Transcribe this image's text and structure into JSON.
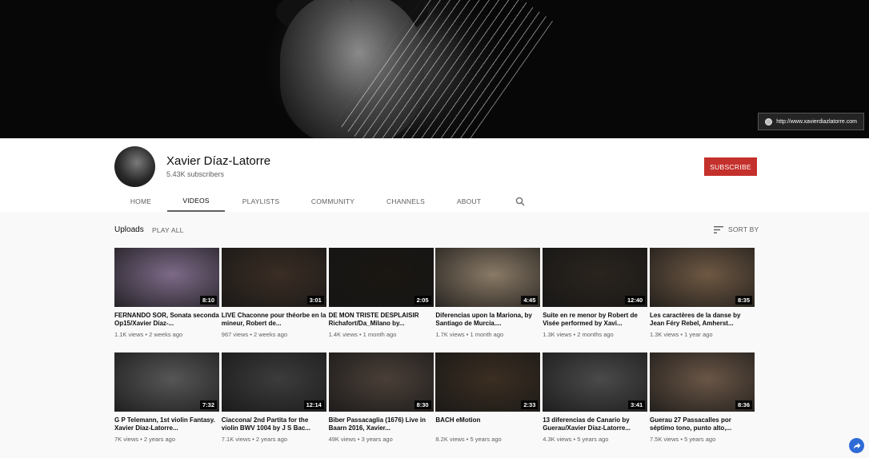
{
  "banner": {
    "link_text": "http://www.xavierdiazlatorre.com"
  },
  "channel": {
    "name": "Xavier Díaz-Latorre",
    "subscribers": "5.43K subscribers",
    "subscribe_label": "SUBSCRIBE"
  },
  "tabs": [
    {
      "label": "HOME"
    },
    {
      "label": "VIDEOS"
    },
    {
      "label": "PLAYLISTS"
    },
    {
      "label": "COMMUNITY"
    },
    {
      "label": "CHANNELS"
    },
    {
      "label": "ABOUT"
    }
  ],
  "section": {
    "title": "Uploads",
    "play_all": "PLAY ALL",
    "sort_by": "SORT BY"
  },
  "videos": [
    {
      "title": "FERNANDO SOR, Sonata seconda Op15/Xavier Díaz-...",
      "views": "1.1K views",
      "age": "2 weeks ago",
      "duration": "8:10",
      "thumb_bg": "#7d6a88"
    },
    {
      "title": "LIVE Chaconne pour théorbe en la mineur, Robert de...",
      "views": "967 views",
      "age": "2 weeks ago",
      "duration": "3:01",
      "thumb_bg": "#3a2d24"
    },
    {
      "title": "DE MON TRISTE DESPLAISIR Richafort/Da_Milano by...",
      "views": "1.4K views",
      "age": "1 month ago",
      "duration": "2:05",
      "thumb_bg": "#1a1612"
    },
    {
      "title": "Diferencias upon la Mariona, by Santiago de Murcia....",
      "views": "1.7K views",
      "age": "1 month ago",
      "duration": "4:45",
      "thumb_bg": "#8a7a66"
    },
    {
      "title": "Suite en re menor by Robert de Visée performed by Xavi...",
      "views": "1.3K views",
      "age": "2 months ago",
      "duration": "12:40",
      "thumb_bg": "#2a241e"
    },
    {
      "title": "Les caractères de la danse by Jean Féry Rebel, Amherst...",
      "views": "1.3K views",
      "age": "1 year ago",
      "duration": "8:35",
      "thumb_bg": "#6e5843"
    },
    {
      "title": "G P Telemann, 1st violin Fantasy. Xavier Díaz-Latorre...",
      "views": "7K views",
      "age": "2 years ago",
      "duration": "7:32",
      "thumb_bg": "#565656"
    },
    {
      "title": "Ciaccona/ 2nd Partita for the violin BWV 1004 by J S Bac...",
      "views": "7.1K views",
      "age": "2 years ago",
      "duration": "12:14",
      "thumb_bg": "#3c3c3c"
    },
    {
      "title": "Biber Passacaglia (1676) Live in Baarn 2016, Xavier...",
      "views": "49K views",
      "age": "3 years ago",
      "duration": "8:30",
      "thumb_bg": "#4a3f38"
    },
    {
      "title": "BACH eMotion",
      "views": "8.2K views",
      "age": "5 years ago",
      "duration": "2:33",
      "thumb_bg": "#3b2e22"
    },
    {
      "title": "13 diferencias de Canario by Guerau/Xavier Díaz-Latorre...",
      "views": "4.3K views",
      "age": "5 years ago",
      "duration": "3:41",
      "thumb_bg": "#4a4a4a"
    },
    {
      "title": "Guerau 27 Passacalles por séptimo tono, punto alto,...",
      "views": "7.5K views",
      "age": "5 years ago",
      "duration": "8:36",
      "thumb_bg": "#6a5646"
    }
  ]
}
